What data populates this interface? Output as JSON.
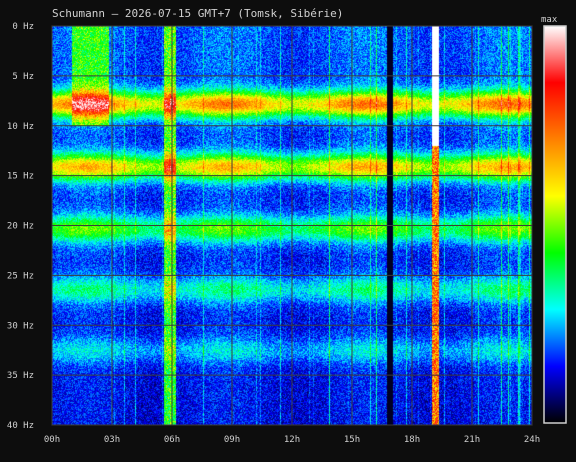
{
  "chart_data": {
    "type": "heatmap",
    "title": "Schumann – 2026-07-15 GMT+7  (Tomsk, Sibérie)",
    "x_tick_labels": [
      "00h",
      "03h",
      "06h",
      "09h",
      "12h",
      "15h",
      "18h",
      "21h",
      "24h"
    ],
    "x_ticks_hours": [
      0,
      3,
      6,
      9,
      12,
      15,
      18,
      21,
      24
    ],
    "y_tick_labels": [
      "0 Hz",
      "5 Hz",
      "10 Hz",
      "15 Hz",
      "20 Hz",
      "25 Hz",
      "30 Hz",
      "35 Hz",
      "40 Hz"
    ],
    "y_ticks_hz": [
      0,
      5,
      10,
      15,
      20,
      25,
      30,
      35,
      40
    ],
    "xlim_hours": [
      0,
      24
    ],
    "ylim_hz": [
      0,
      40
    ],
    "y_inverted": true,
    "grid": true,
    "colorbar": {
      "label": "max",
      "colors": [
        "#000000",
        "#0000ff",
        "#00ffff",
        "#00ff00",
        "#ffff00",
        "#ff8000",
        "#ff0000",
        "#ffffff"
      ]
    },
    "resonance_bands_hz": [
      {
        "center": 7.8,
        "intensity": 0.62
      },
      {
        "center": 14.1,
        "intensity": 0.55
      },
      {
        "center": 20.3,
        "intensity": 0.35
      },
      {
        "center": 26.4,
        "intensity": 0.22
      },
      {
        "center": 32.5,
        "intensity": 0.15
      }
    ],
    "events": [
      {
        "start_h": 1.0,
        "end_h": 2.8,
        "freq_max_hz": 10,
        "intensity": 0.3,
        "kind": "noise"
      },
      {
        "start_h": 5.6,
        "end_h": 6.2,
        "freq_max_hz": 40,
        "intensity": 0.4,
        "kind": "burst"
      },
      {
        "start_h": 16.75,
        "end_h": 17.0,
        "freq_max_hz": 40,
        "intensity": 0.0,
        "kind": "data-gap"
      },
      {
        "start_h": 19.0,
        "end_h": 19.3,
        "freq_max_hz": 40,
        "intensity": 1.0,
        "kind": "saturation"
      }
    ]
  }
}
